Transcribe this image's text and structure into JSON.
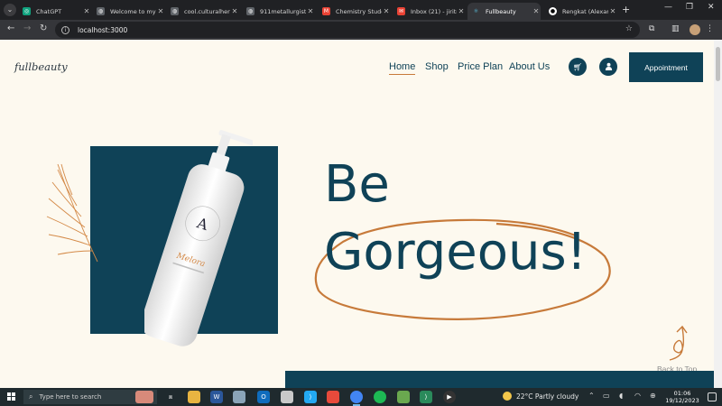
{
  "browser": {
    "tabs": [
      {
        "title": "ChatGPT",
        "icon": "chatgpt-icon",
        "color": "#10a37f"
      },
      {
        "title": "Welcome to my",
        "icon": "globe-icon",
        "color": "#5f6368"
      },
      {
        "title": "cool.culturalheri",
        "icon": "globe-icon",
        "color": "#5f6368"
      },
      {
        "title": "911metallurgist.c",
        "icon": "globe-icon",
        "color": "#5f6368"
      },
      {
        "title": "Chemistry Stude",
        "icon": "gmail-icon",
        "color": "#ea4335"
      },
      {
        "title": "Inbox (21) - jiritr",
        "icon": "mail-icon",
        "color": "#ea4335"
      },
      {
        "title": "Fullbeauty",
        "icon": "react-icon",
        "color": "#61dafb"
      },
      {
        "title": "Rengkat (Alexan",
        "icon": "github-icon",
        "color": "#ffffff"
      }
    ],
    "active_tab_index": 6,
    "url": "localhost:3000"
  },
  "page": {
    "logo": "fullbeauty",
    "nav": [
      {
        "label": "Home",
        "active": true
      },
      {
        "label": "Shop",
        "active": false
      },
      {
        "label": "Price Plan",
        "active": false
      },
      {
        "label": "About Us",
        "active": false
      }
    ],
    "cart_icon": "cart-icon",
    "user_icon": "user-icon",
    "appointment_label": "Appointment",
    "hero_line1": "Be",
    "hero_line2": "Gorgeous!",
    "product": {
      "brand_ring": "Allora Beauty Cosmetics",
      "monogram": "A",
      "name": "Melora",
      "subtitle": "hair cream with sea",
      "volume": "200 ml"
    },
    "back_to_top": "Back to Top",
    "colors": {
      "accent": "#0f4257",
      "orange": "#c77a3a",
      "background": "#fdf9ef"
    }
  },
  "taskbar": {
    "search_placeholder": "Type here to search",
    "weather": "22°C  Partly cloudy",
    "time": "01:06",
    "date": "19/12/2023"
  }
}
